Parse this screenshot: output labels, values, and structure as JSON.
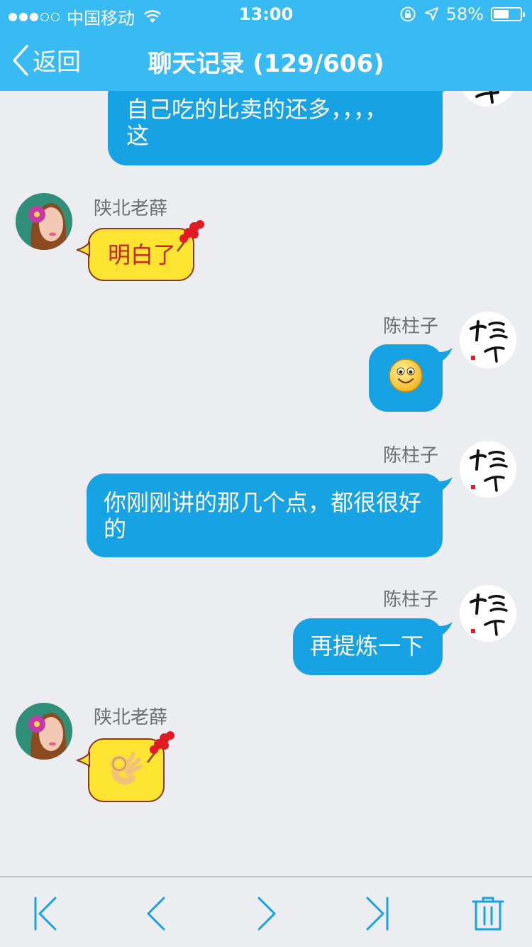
{
  "status_bar": {
    "carrier": "中国移动",
    "time": "13:00",
    "battery": "58%",
    "battery_level": 0.58,
    "signal_bars": 3
  },
  "nav": {
    "back_label": "返回",
    "title": "聊天记录 (129/606)"
  },
  "messages": [
    {
      "side": "right",
      "text_line1": "自己吃的比卖的还多，，，，",
      "text_line2": "这"
    },
    {
      "side": "left",
      "sender": "陕北老薛",
      "text": "明白了",
      "style": "yellow"
    },
    {
      "side": "right",
      "sender": "陈柱子",
      "emoji": "smile-emoji"
    },
    {
      "side": "right",
      "sender": "陈柱子",
      "text_line1": "你刚刚讲的那几个点，都很很好",
      "text_line2": "的"
    },
    {
      "side": "right",
      "sender": "陈柱子",
      "text": "再提炼一下"
    },
    {
      "side": "left",
      "sender": "陕北老薛",
      "emoji": "ok-hand-emoji",
      "style": "yellow"
    }
  ],
  "toolbar": {
    "buttons": [
      "first-page-icon",
      "previous-page-icon",
      "next-page-icon",
      "last-page-icon",
      "trash-icon"
    ]
  },
  "colors": {
    "header": "#38baf2",
    "bubble_blue": "#17a2e4",
    "bubble_yellow": "#fde430",
    "background": "#ebedf1",
    "icon": "#17a2e4"
  }
}
